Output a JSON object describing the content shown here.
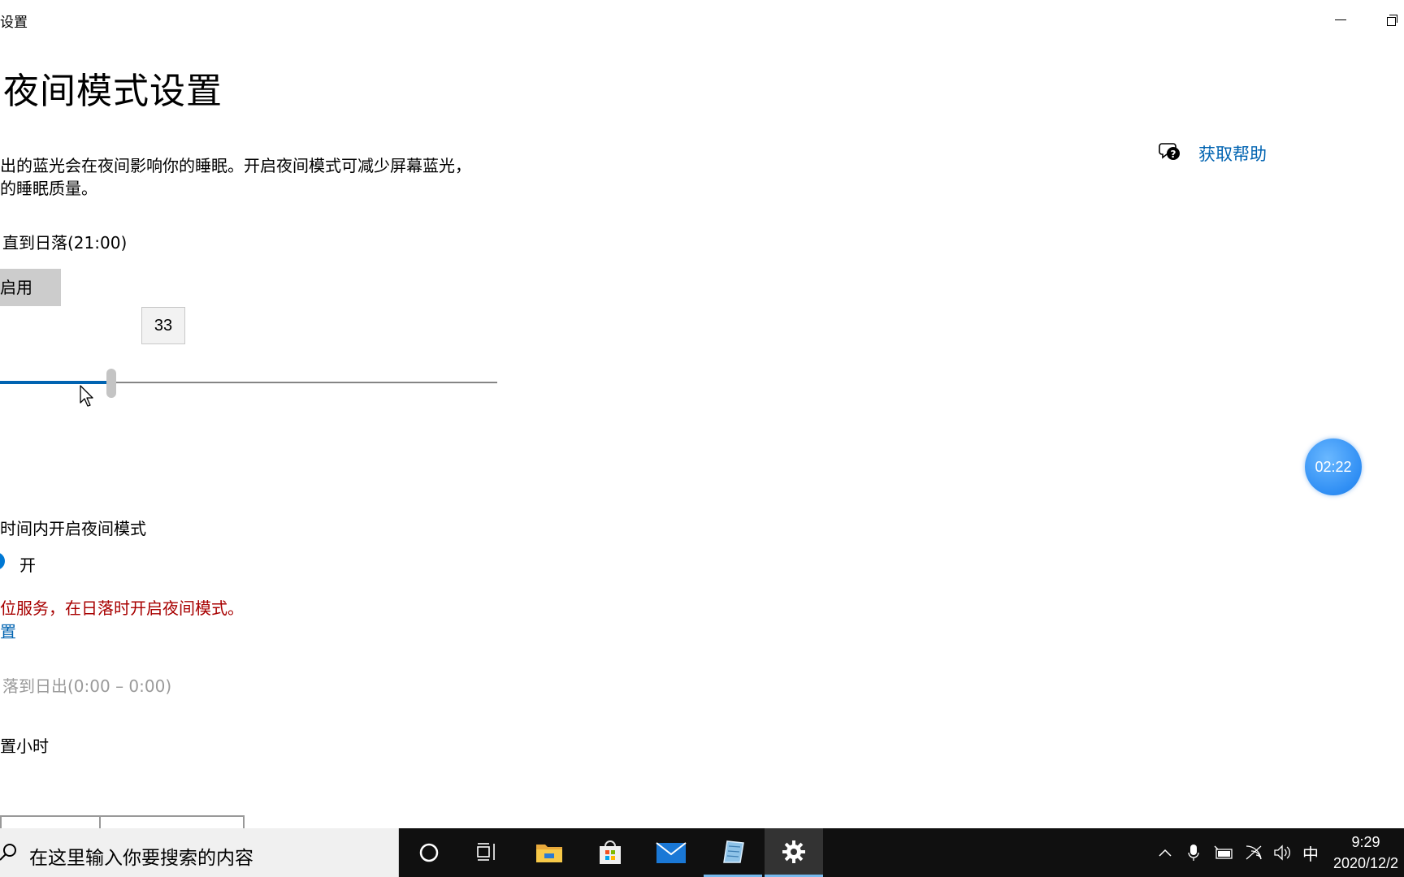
{
  "window": {
    "title": "设置"
  },
  "page": {
    "title": "夜间模式设置",
    "description_line1": "出的蓝光会在夜间影响你的睡眠。开启夜间模式可减少屏幕蓝光，",
    "description_line2": "的睡眠质量。",
    "status": "直到日落(21:00)",
    "enable_button": "启用",
    "strength_value": "33",
    "strength_level": 33
  },
  "help": {
    "label": "获取帮助"
  },
  "timer": {
    "value": "02:22"
  },
  "schedule": {
    "label": "时间内开启夜间模式",
    "toggle_label": "开",
    "location_warning": "位服务，在日落时开启夜间模式。",
    "location_link": "置",
    "sunset_option": "落到日出(0:00 – 0:00)",
    "set_hours_option": "置小时"
  },
  "taskbar": {
    "search_placeholder": "在这里输入你要搜索的内容",
    "icons": [
      "cortana-icon",
      "task-view-icon",
      "file-explorer-icon",
      "store-icon",
      "mail-icon",
      "notepad-icon",
      "settings-icon"
    ],
    "ime": "中",
    "time": "9:29",
    "date": "2020/12/2"
  },
  "colors": {
    "accent": "#0063b1",
    "warning": "#a80000",
    "taskbar": "#101010"
  }
}
